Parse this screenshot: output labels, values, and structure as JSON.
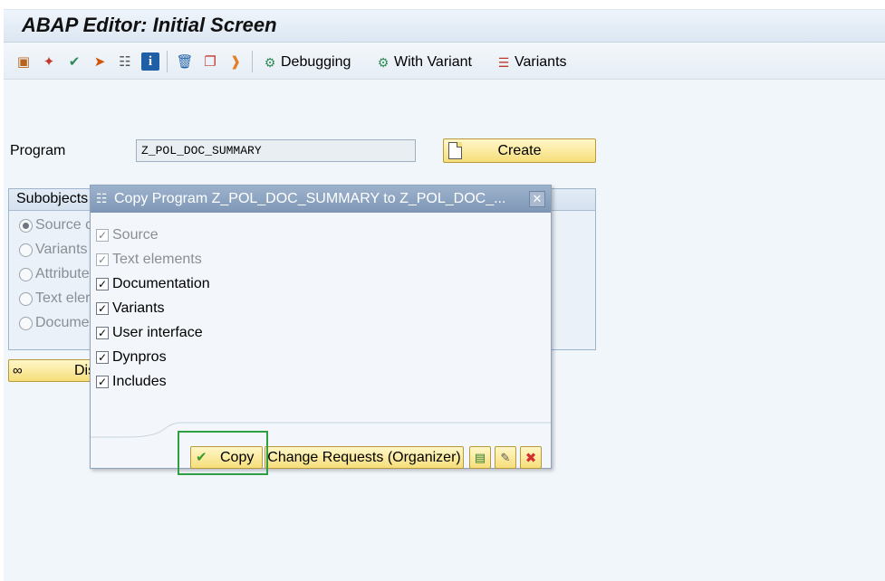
{
  "window": {
    "title": "ABAP Editor: Initial Screen"
  },
  "toolbar": {
    "icons": [
      "hierarchy-icon",
      "magic-wand-icon",
      "check-icon",
      "transport-icon",
      "where-used-icon",
      "info-icon",
      "delete-icon",
      "copy-icon",
      "rename-icon"
    ],
    "debugging_label": "Debugging",
    "with_variant_label": "With Variant",
    "variants_label": "Variants"
  },
  "program": {
    "label": "Program",
    "value": "Z_POL_DOC_SUMMARY",
    "create_label": "Create"
  },
  "subobjects": {
    "title": "Subobjects",
    "options": [
      "Source c",
      "Variants",
      "Attribute",
      "Text eler",
      "Docume"
    ],
    "selected": "Source c",
    "display_label": "Dis"
  },
  "dialog": {
    "title": "Copy Program Z_POL_DOC_SUMMARY to Z_POL_DOC_...",
    "items": [
      {
        "label": "Source",
        "checked": true,
        "disabled": true
      },
      {
        "label": "Text elements",
        "checked": true,
        "disabled": true
      },
      {
        "label": "Documentation",
        "checked": true,
        "disabled": false
      },
      {
        "label": "Variants",
        "checked": true,
        "disabled": false
      },
      {
        "label": "User interface",
        "checked": true,
        "disabled": false
      },
      {
        "label": "Dynpros",
        "checked": true,
        "disabled": false
      },
      {
        "label": "Includes",
        "checked": true,
        "disabled": false
      }
    ],
    "copy_label": "Copy",
    "change_requests_label": "Change Requests (Organizer)"
  },
  "colors": {
    "highlight": "#2ea043",
    "button_yellow": "#f6de7a",
    "dialog_title": "#8aa0bd"
  }
}
